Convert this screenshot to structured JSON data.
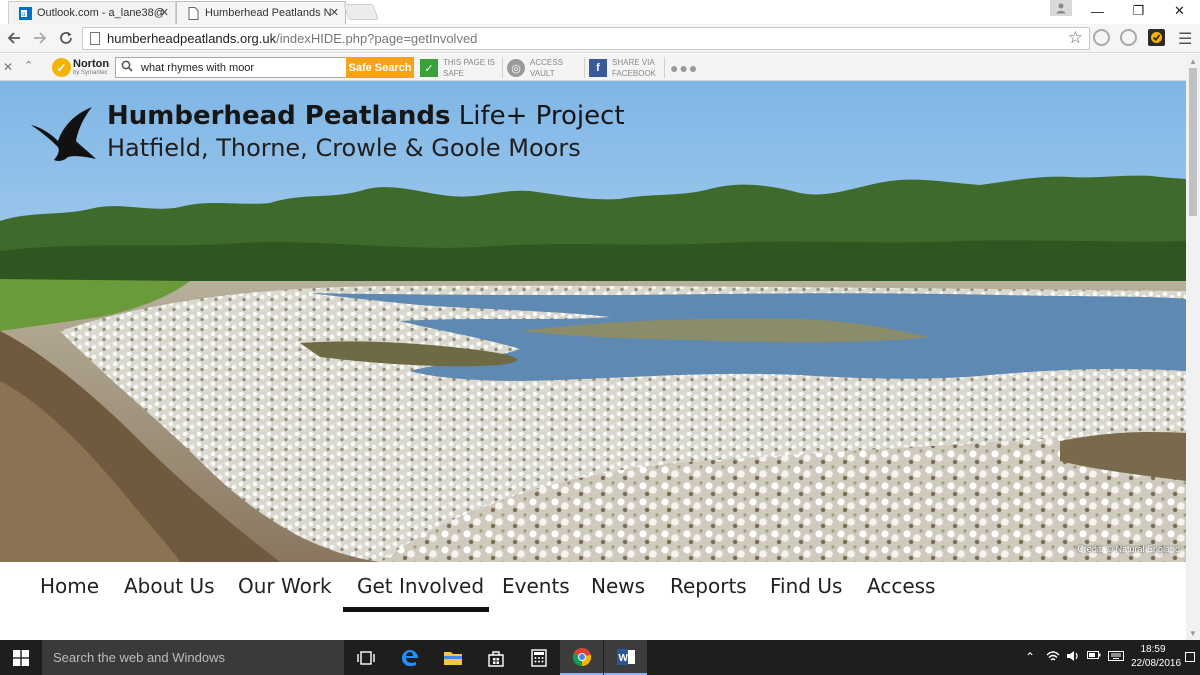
{
  "browser": {
    "tabs": [
      {
        "title": "Outlook.com - a_lane38@",
        "active": false
      },
      {
        "title": "Humberhead Peatlands N",
        "active": true
      }
    ],
    "tab_close": "✕",
    "window_controls": {
      "minimize": "—",
      "restore": "❐",
      "close": "✕"
    },
    "url": {
      "host": "humberheadpeatlands.org.uk",
      "path": "/indexHIDE.php?page=getInvolved"
    }
  },
  "norton_bar": {
    "brand": "Norton",
    "brand_sub": "by Symantec",
    "search_value": "what rhymes with moor",
    "safe_search_label": "Safe Search",
    "page_safe": {
      "line1": "THIS PAGE IS",
      "line2": "SAFE"
    },
    "access_vault": {
      "line1": "ACCESS",
      "line2": "VAULT"
    },
    "share_facebook": {
      "line1": "SHARE VIA",
      "line2": "FACEBOOK"
    },
    "more": "●●●"
  },
  "site": {
    "title_bold": "Humberhead Peatlands",
    "title_rest": " Life+ Project",
    "subtitle": "Hatfield, Thorne, Crowle & Goole Moors",
    "photo_credit": "Credit: © Natural England",
    "nav": [
      {
        "label": "Home",
        "active": false
      },
      {
        "label": "About Us",
        "active": false
      },
      {
        "label": "Our Work",
        "active": false
      },
      {
        "label": "Get Involved",
        "active": true
      },
      {
        "label": "Events",
        "active": false
      },
      {
        "label": "News",
        "active": false
      },
      {
        "label": "Reports",
        "active": false
      },
      {
        "label": "Find Us",
        "active": false
      },
      {
        "label": "Access",
        "active": false
      }
    ]
  },
  "taskbar": {
    "search_placeholder": "Search the web and Windows",
    "icons": [
      "task-view-icon",
      "edge-icon",
      "file-explorer-icon",
      "store-icon",
      "calculator-icon",
      "chrome-icon",
      "word-icon"
    ],
    "clock_time": "18:59",
    "clock_date": "22/08/2016"
  },
  "colors": {
    "norton_yellow": "#f5b400",
    "safe_search_orange": "#f7a21b",
    "taskbar": "#1e1e1e",
    "nav_underline": "#111111"
  }
}
